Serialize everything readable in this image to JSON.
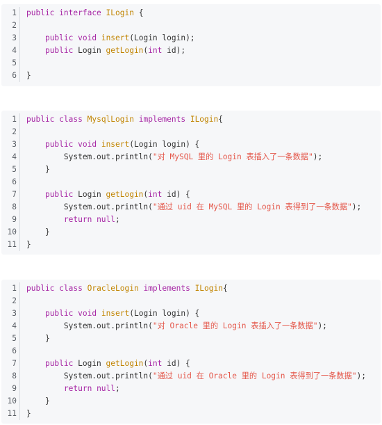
{
  "blocks": [
    {
      "id": "ilogin",
      "lines": [
        {
          "num": "1",
          "tokens": [
            {
              "t": "public",
              "c": "kw"
            },
            {
              "t": " ",
              "c": "txt"
            },
            {
              "t": "interface",
              "c": "kw"
            },
            {
              "t": " ",
              "c": "txt"
            },
            {
              "t": "ILogin",
              "c": "fn"
            },
            {
              "t": " {",
              "c": "txt"
            }
          ]
        },
        {
          "num": "2",
          "tokens": []
        },
        {
          "num": "3",
          "tokens": [
            {
              "t": "    ",
              "c": "txt"
            },
            {
              "t": "public",
              "c": "kw"
            },
            {
              "t": " ",
              "c": "txt"
            },
            {
              "t": "void",
              "c": "kw"
            },
            {
              "t": " ",
              "c": "txt"
            },
            {
              "t": "insert",
              "c": "fn"
            },
            {
              "t": "(Login login);",
              "c": "txt"
            }
          ]
        },
        {
          "num": "4",
          "tokens": [
            {
              "t": "    ",
              "c": "txt"
            },
            {
              "t": "public",
              "c": "kw"
            },
            {
              "t": " Login ",
              "c": "txt"
            },
            {
              "t": "getLogin",
              "c": "fn"
            },
            {
              "t": "(",
              "c": "txt"
            },
            {
              "t": "int",
              "c": "kw"
            },
            {
              "t": " id);",
              "c": "txt"
            }
          ]
        },
        {
          "num": "5",
          "tokens": []
        },
        {
          "num": "6",
          "tokens": [
            {
              "t": "}",
              "c": "txt"
            }
          ]
        }
      ]
    },
    {
      "id": "mysql",
      "lines": [
        {
          "num": "1",
          "tokens": [
            {
              "t": "public",
              "c": "kw"
            },
            {
              "t": " ",
              "c": "txt"
            },
            {
              "t": "class",
              "c": "kw"
            },
            {
              "t": " ",
              "c": "txt"
            },
            {
              "t": "MysqlLogin",
              "c": "fn"
            },
            {
              "t": " ",
              "c": "txt"
            },
            {
              "t": "implements",
              "c": "kw"
            },
            {
              "t": " ",
              "c": "txt"
            },
            {
              "t": "ILogin",
              "c": "fn"
            },
            {
              "t": "{",
              "c": "txt"
            }
          ]
        },
        {
          "num": "2",
          "tokens": []
        },
        {
          "num": "3",
          "tokens": [
            {
              "t": "    ",
              "c": "txt"
            },
            {
              "t": "public",
              "c": "kw"
            },
            {
              "t": " ",
              "c": "txt"
            },
            {
              "t": "void",
              "c": "kw"
            },
            {
              "t": " ",
              "c": "txt"
            },
            {
              "t": "insert",
              "c": "fn"
            },
            {
              "t": "(Login login) {",
              "c": "txt"
            }
          ]
        },
        {
          "num": "4",
          "tokens": [
            {
              "t": "        System.out.println(",
              "c": "txt"
            },
            {
              "t": "\"对 MySQL 里的 Login 表插入了一条数据\"",
              "c": "str"
            },
            {
              "t": ");",
              "c": "txt"
            }
          ]
        },
        {
          "num": "5",
          "tokens": [
            {
              "t": "    }",
              "c": "txt"
            }
          ]
        },
        {
          "num": "6",
          "tokens": []
        },
        {
          "num": "7",
          "tokens": [
            {
              "t": "    ",
              "c": "txt"
            },
            {
              "t": "public",
              "c": "kw"
            },
            {
              "t": " Login ",
              "c": "txt"
            },
            {
              "t": "getLogin",
              "c": "fn"
            },
            {
              "t": "(",
              "c": "txt"
            },
            {
              "t": "int",
              "c": "kw"
            },
            {
              "t": " id) {",
              "c": "txt"
            }
          ]
        },
        {
          "num": "8",
          "tokens": [
            {
              "t": "        System.out.println(",
              "c": "txt"
            },
            {
              "t": "\"通过 uid 在 MySQL 里的 Login 表得到了一条数据\"",
              "c": "str"
            },
            {
              "t": ");",
              "c": "txt"
            }
          ]
        },
        {
          "num": "9",
          "tokens": [
            {
              "t": "        ",
              "c": "txt"
            },
            {
              "t": "return",
              "c": "kw"
            },
            {
              "t": " ",
              "c": "txt"
            },
            {
              "t": "null",
              "c": "kw"
            },
            {
              "t": ";",
              "c": "txt"
            }
          ]
        },
        {
          "num": "10",
          "tokens": [
            {
              "t": "    }",
              "c": "txt"
            }
          ]
        },
        {
          "num": "11",
          "tokens": [
            {
              "t": "}",
              "c": "txt"
            }
          ]
        }
      ]
    },
    {
      "id": "oracle",
      "lines": [
        {
          "num": "1",
          "tokens": [
            {
              "t": "public",
              "c": "kw"
            },
            {
              "t": " ",
              "c": "txt"
            },
            {
              "t": "class",
              "c": "kw"
            },
            {
              "t": " ",
              "c": "txt"
            },
            {
              "t": "OracleLogin",
              "c": "fn"
            },
            {
              "t": " ",
              "c": "txt"
            },
            {
              "t": "implements",
              "c": "kw"
            },
            {
              "t": " ",
              "c": "txt"
            },
            {
              "t": "ILogin",
              "c": "fn"
            },
            {
              "t": "{",
              "c": "txt"
            }
          ]
        },
        {
          "num": "2",
          "tokens": []
        },
        {
          "num": "3",
          "tokens": [
            {
              "t": "    ",
              "c": "txt"
            },
            {
              "t": "public",
              "c": "kw"
            },
            {
              "t": " ",
              "c": "txt"
            },
            {
              "t": "void",
              "c": "kw"
            },
            {
              "t": " ",
              "c": "txt"
            },
            {
              "t": "insert",
              "c": "fn"
            },
            {
              "t": "(Login login) {",
              "c": "txt"
            }
          ]
        },
        {
          "num": "4",
          "tokens": [
            {
              "t": "        System.out.println(",
              "c": "txt"
            },
            {
              "t": "\"对 Oracle 里的 Login 表插入了一条数据\"",
              "c": "str"
            },
            {
              "t": ");",
              "c": "txt"
            }
          ]
        },
        {
          "num": "5",
          "tokens": [
            {
              "t": "    }",
              "c": "txt"
            }
          ]
        },
        {
          "num": "6",
          "tokens": []
        },
        {
          "num": "7",
          "tokens": [
            {
              "t": "    ",
              "c": "txt"
            },
            {
              "t": "public",
              "c": "kw"
            },
            {
              "t": " Login ",
              "c": "txt"
            },
            {
              "t": "getLogin",
              "c": "fn"
            },
            {
              "t": "(",
              "c": "txt"
            },
            {
              "t": "int",
              "c": "kw"
            },
            {
              "t": " id) {",
              "c": "txt"
            }
          ]
        },
        {
          "num": "8",
          "tokens": [
            {
              "t": "        System.out.println(",
              "c": "txt"
            },
            {
              "t": "\"通过 uid 在 Oracle 里的 Login 表得到了一条数据\"",
              "c": "str"
            },
            {
              "t": ");",
              "c": "txt"
            }
          ]
        },
        {
          "num": "9",
          "tokens": [
            {
              "t": "        ",
              "c": "txt"
            },
            {
              "t": "return",
              "c": "kw"
            },
            {
              "t": " ",
              "c": "txt"
            },
            {
              "t": "null",
              "c": "kw"
            },
            {
              "t": ";",
              "c": "txt"
            }
          ]
        },
        {
          "num": "10",
          "tokens": [
            {
              "t": "    }",
              "c": "txt"
            }
          ]
        },
        {
          "num": "11",
          "tokens": [
            {
              "t": "}",
              "c": "txt"
            }
          ]
        }
      ]
    }
  ]
}
